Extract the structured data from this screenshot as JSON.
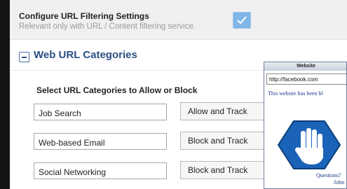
{
  "config": {
    "title": "Configure URL Filtering Settings",
    "subtitle": "Relevant only with URL / Content filtering service.",
    "checkbox_checked": true
  },
  "section": {
    "toggle_glyph": "−",
    "title": "Web URL Categories",
    "select_label": "Select URL Categories to Allow or Block"
  },
  "categories": [
    {
      "name": "Job Search",
      "action": "Allow and Track"
    },
    {
      "name": "Web-based Email",
      "action": "Block and Track"
    },
    {
      "name": "Social Networking",
      "action": "Block and Track"
    }
  ],
  "popup": {
    "title": "Website",
    "url": "http://facebook.com",
    "message": "This website has been bl",
    "questions": "Questions?",
    "contact": "John"
  },
  "colors": {
    "accent": "#2b4f86",
    "checkbox": "#7fb6e6",
    "popup_text": "#1c3a8a",
    "shield": "#1a63b8"
  }
}
